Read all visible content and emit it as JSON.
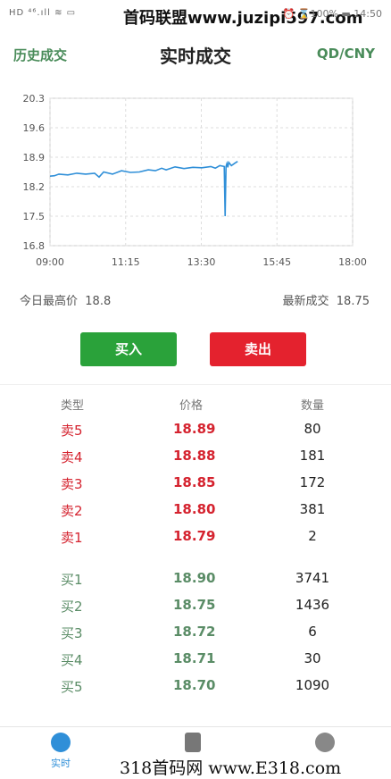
{
  "status": {
    "left": "HD ⁴⁶.ıll ≋ ▭",
    "watermark": "首码联盟www.juzipi597.com",
    "right": "⏰ ⌛100% ▬ 14:50"
  },
  "nav": {
    "left": "历史成交",
    "title": "实时成交",
    "right": "QD/CNY"
  },
  "colors": {
    "green": "#2aa23a",
    "red": "#e4222e",
    "line": "#2f8fd8"
  },
  "chart_data": {
    "type": "line",
    "x_ticks": [
      "09:00",
      "11:15",
      "13:30",
      "15:45",
      "18:00"
    ],
    "y_ticks": [
      "20.3",
      "19.6",
      "18.9",
      "18.2",
      "17.5",
      "16.8"
    ],
    "ylim": [
      16.8,
      20.3
    ],
    "grid": true,
    "series": [
      {
        "x": [
          0,
          5,
          10,
          20,
          30,
          40,
          50,
          55,
          60,
          70,
          80,
          90,
          100,
          110,
          118,
          125,
          130,
          140,
          150,
          160,
          170,
          180,
          185,
          190,
          195,
          196,
          197,
          198,
          199,
          200,
          203,
          207,
          210
        ],
        "y": [
          18.45,
          18.46,
          18.5,
          18.48,
          18.52,
          18.5,
          18.52,
          18.43,
          18.55,
          18.5,
          18.58,
          18.54,
          18.55,
          18.6,
          18.58,
          18.64,
          18.6,
          18.67,
          18.63,
          18.66,
          18.65,
          18.68,
          18.64,
          18.7,
          18.68,
          17.5,
          18.68,
          18.75,
          18.66,
          18.78,
          18.7,
          18.76,
          18.8
        ]
      }
    ]
  },
  "info": {
    "high_label": "今日最高价",
    "high_value": "18.8",
    "last_label": "最新成交",
    "last_value": "18.75"
  },
  "buttons": {
    "buy": "买入",
    "sell": "卖出"
  },
  "table": {
    "headers": [
      "类型",
      "价格",
      "数量"
    ],
    "asks": [
      {
        "type": "卖5",
        "price": "18.89",
        "qty": "80"
      },
      {
        "type": "卖4",
        "price": "18.88",
        "qty": "181"
      },
      {
        "type": "卖3",
        "price": "18.85",
        "qty": "172"
      },
      {
        "type": "卖2",
        "price": "18.80",
        "qty": "381"
      },
      {
        "type": "卖1",
        "price": "18.79",
        "qty": "2"
      }
    ],
    "bids": [
      {
        "type": "买1",
        "price": "18.90",
        "qty": "3741"
      },
      {
        "type": "买2",
        "price": "18.75",
        "qty": "1436"
      },
      {
        "type": "买3",
        "price": "18.72",
        "qty": "6"
      },
      {
        "type": "买4",
        "price": "18.71",
        "qty": "30"
      },
      {
        "type": "买5",
        "price": "18.70",
        "qty": "1090"
      }
    ]
  },
  "tabbar": {
    "tab1": "实时",
    "tab1_icon": "refresh-icon",
    "tab2_icon": "clipboard-icon",
    "tab3_icon": "user-icon"
  },
  "footer_watermark": "318首码网 www.E318.com"
}
